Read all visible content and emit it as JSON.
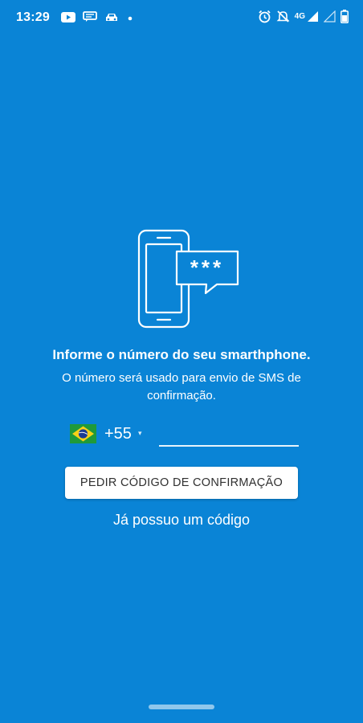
{
  "status_bar": {
    "time": "13:29",
    "network": "4G",
    "icons": [
      "youtube-icon",
      "chat-icon",
      "car-icon",
      "dot-icon",
      "alarm-icon",
      "mute-icon",
      "signal-icon",
      "battery-icon"
    ]
  },
  "login": {
    "title": "Informe o número do seu smarthphone.",
    "subtitle": "O número será usado para envio de SMS de confirmação.",
    "country_code": "+55",
    "dropdown_caret": "▾",
    "phone_value": "",
    "phone_placeholder": "",
    "request_button": "PEDIR CÓDIGO DE CONFIRMAÇÃO",
    "have_code_link": "Já possuo um código",
    "sms_bubble_text": "***"
  },
  "colors": {
    "background": "#0a84d6",
    "button_bg": "#ffffff",
    "button_text": "#303030",
    "flag_green": "#1f9a3a",
    "flag_yellow": "#f7d117",
    "flag_blue": "#1b3c91"
  }
}
